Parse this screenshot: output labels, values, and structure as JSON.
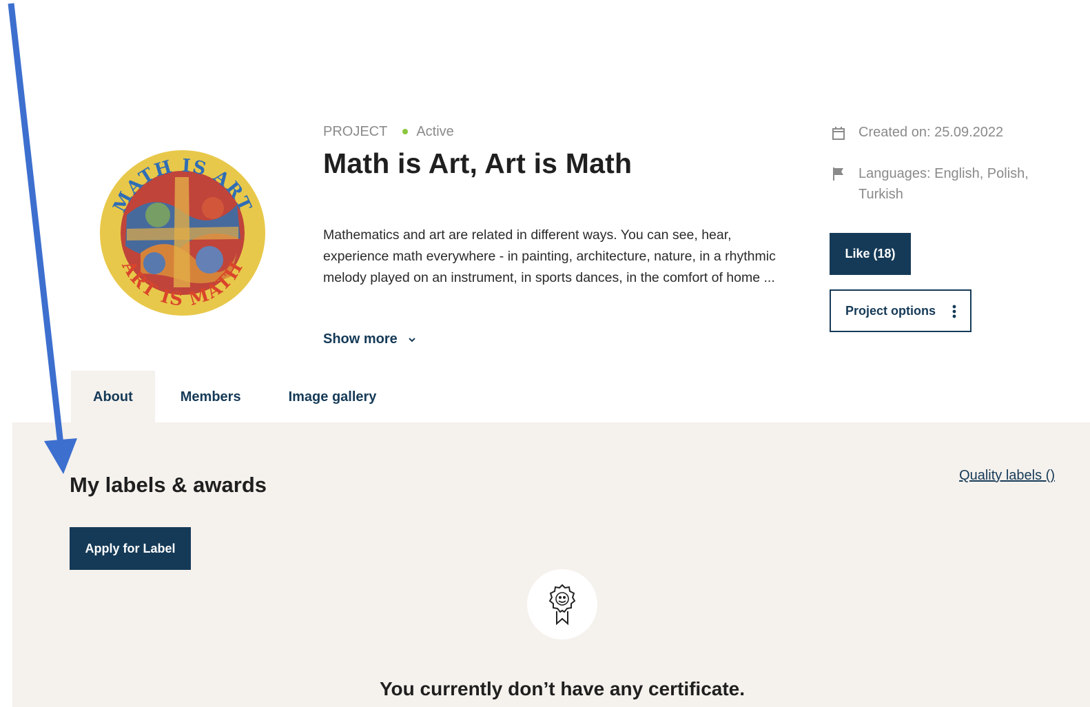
{
  "project": {
    "type_label": "PROJECT",
    "status": "Active",
    "status_color": "#8cc63f",
    "title": "Math is Art, Art is Math",
    "description": "Mathematics and art are related in different ways. You can see, hear, experience math everywhere - in painting, architecture, nature, in a rhythmic melody played on an instrument, in sports dances, in the comfort of home ...",
    "show_more_label": "Show more",
    "logo": {
      "top_text": "MATH IS ART",
      "bottom_text": "ART IS MATH",
      "ring_color": "#e8c84a",
      "text_top_color": "#2f6db5",
      "text_bottom_color": "#d9452b"
    }
  },
  "meta": {
    "created": "Created on: 25.09.2022",
    "languages": "Languages: English, Polish, Turkish",
    "calendar_icon": "calendar-icon",
    "flag_icon": "flag-icon"
  },
  "actions": {
    "like_label": "Like (18)",
    "options_label": "Project options"
  },
  "tabs": [
    {
      "label": "About",
      "active": true
    },
    {
      "label": "Members",
      "active": false
    },
    {
      "label": "Image gallery",
      "active": false
    }
  ],
  "labels_section": {
    "title": "My labels & awards",
    "quality_link": "Quality labels ()",
    "apply_label": "Apply for Label",
    "empty_message": "You currently don’t have any certificate.",
    "badge_icon": "award-badge-icon"
  },
  "colors": {
    "primary": "#153a57",
    "panel_bg": "#f5f1ed",
    "annotation_arrow": "#3d6fcf"
  }
}
